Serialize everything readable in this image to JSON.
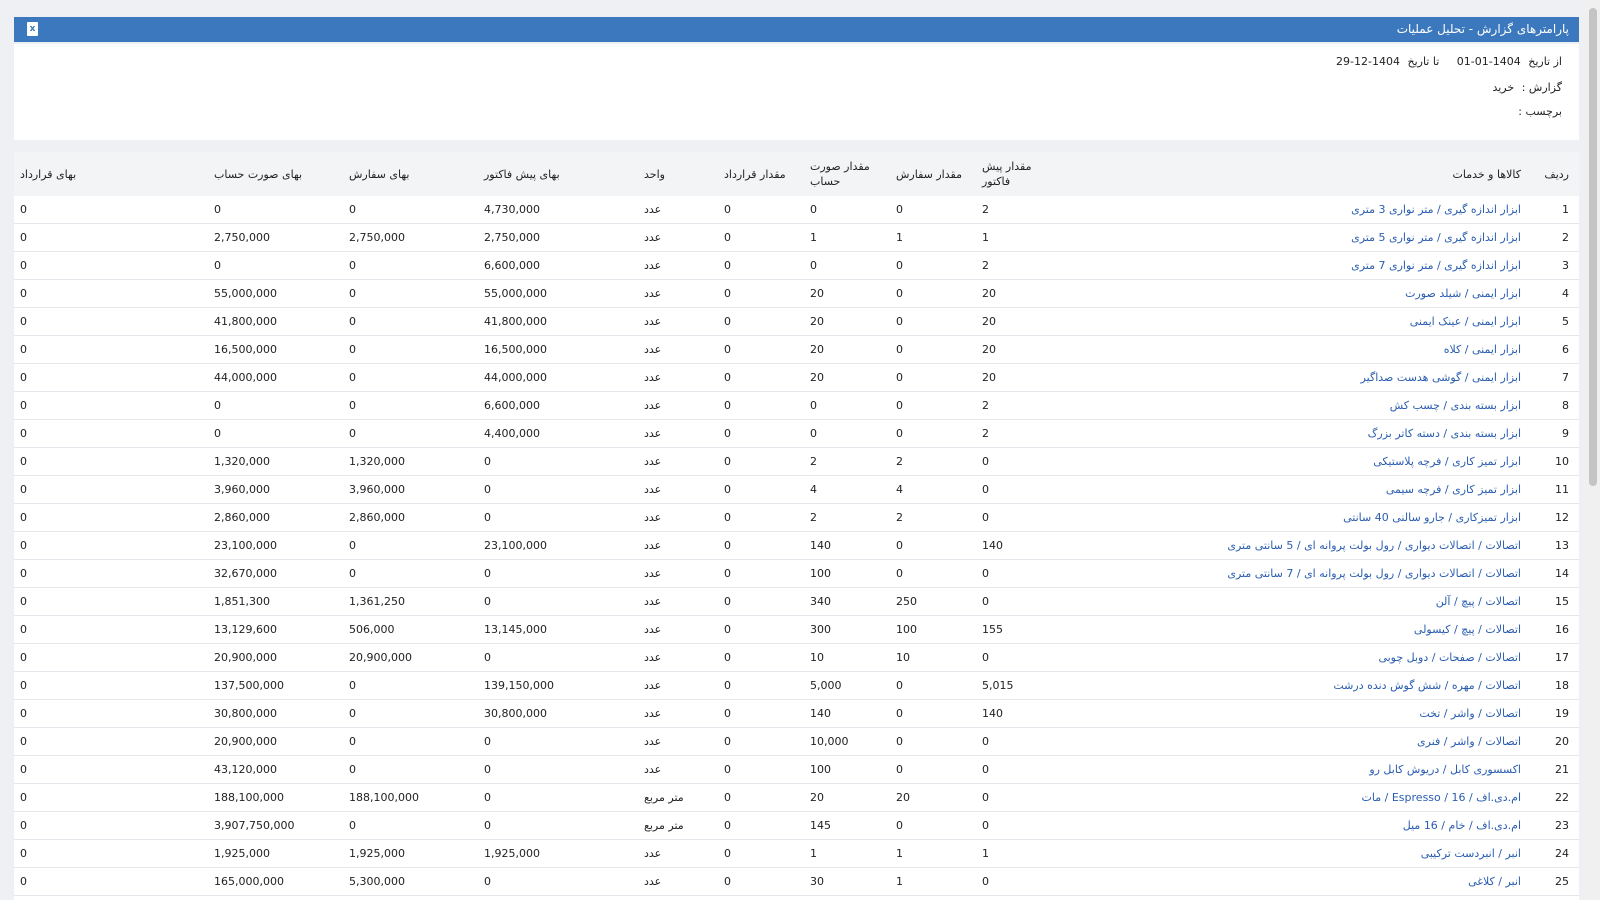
{
  "header": {
    "title": "پارامترهای گزارش - تحلیل عملیات",
    "export_icon": "excel-icon"
  },
  "params": {
    "from_label": "از تاریخ",
    "from_value": "1404-01-01",
    "to_label": "تا تاریخ",
    "to_value": "1404-12-29",
    "report_label": "گزارش :",
    "report_value": "خرید",
    "tag_label": "برچسب :"
  },
  "table": {
    "columns": [
      "ردیف",
      "کالاها و خدمات",
      "مقدار پیش فاکتور",
      "مقدار سفارش",
      "مقدار صورت حساب",
      "مقدار قرارداد",
      "واحد",
      "بهای پیش فاکتور",
      "بهای سفارش",
      "بهای صورت حساب",
      "بهای قرارداد"
    ],
    "rows": [
      [
        "1",
        "ابزار اندازه گیری / متر نواری 3 متری",
        "2",
        "0",
        "0",
        "0",
        "عدد",
        "4,730,000",
        "0",
        "0",
        "0"
      ],
      [
        "2",
        "ابزار اندازه گیری / متر نواری 5 متری",
        "1",
        "1",
        "1",
        "0",
        "عدد",
        "2,750,000",
        "2,750,000",
        "2,750,000",
        "0"
      ],
      [
        "3",
        "ابزار اندازه گیری / متر نواری 7 متری",
        "2",
        "0",
        "0",
        "0",
        "عدد",
        "6,600,000",
        "0",
        "0",
        "0"
      ],
      [
        "4",
        "ابزار ایمنی / شیلد صورت",
        "20",
        "0",
        "20",
        "0",
        "عدد",
        "55,000,000",
        "0",
        "55,000,000",
        "0"
      ],
      [
        "5",
        "ابزار ایمنی / عینک ایمنی",
        "20",
        "0",
        "20",
        "0",
        "عدد",
        "41,800,000",
        "0",
        "41,800,000",
        "0"
      ],
      [
        "6",
        "ابزار ایمنی / کلاه",
        "20",
        "0",
        "20",
        "0",
        "عدد",
        "16,500,000",
        "0",
        "16,500,000",
        "0"
      ],
      [
        "7",
        "ابزار ایمنی / گوشی هدست صداگیر",
        "20",
        "0",
        "20",
        "0",
        "عدد",
        "44,000,000",
        "0",
        "44,000,000",
        "0"
      ],
      [
        "8",
        "ابزار بسته بندی / چسب کش",
        "2",
        "0",
        "0",
        "0",
        "عدد",
        "6,600,000",
        "0",
        "0",
        "0"
      ],
      [
        "9",
        "ابزار بسته بندی / دسته کاتر بزرگ",
        "2",
        "0",
        "0",
        "0",
        "عدد",
        "4,400,000",
        "0",
        "0",
        "0"
      ],
      [
        "10",
        "ابزار تمیز کاری / فرچه پلاستیکی",
        "0",
        "2",
        "2",
        "0",
        "عدد",
        "0",
        "1,320,000",
        "1,320,000",
        "0"
      ],
      [
        "11",
        "ابزار تمیز کاری / فرچه سیمی",
        "0",
        "4",
        "4",
        "0",
        "عدد",
        "0",
        "3,960,000",
        "3,960,000",
        "0"
      ],
      [
        "12",
        "ابزار تمیزکاری / جارو سالنی 40 سانتی",
        "0",
        "2",
        "2",
        "0",
        "عدد",
        "0",
        "2,860,000",
        "2,860,000",
        "0"
      ],
      [
        "13",
        "اتصالات / اتصالات دیواری / رول بولت پروانه ای / 5 سانتی متری",
        "140",
        "0",
        "140",
        "0",
        "عدد",
        "23,100,000",
        "0",
        "23,100,000",
        "0"
      ],
      [
        "14",
        "اتصالات / اتصالات دیواری / رول بولت پروانه ای / 7 سانتی متری",
        "0",
        "0",
        "100",
        "0",
        "عدد",
        "0",
        "0",
        "32,670,000",
        "0"
      ],
      [
        "15",
        "اتصالات / پیچ / آلن",
        "0",
        "250",
        "340",
        "0",
        "عدد",
        "0",
        "1,361,250",
        "1,851,300",
        "0"
      ],
      [
        "16",
        "اتصالات / پیچ / کیسولی",
        "155",
        "100",
        "300",
        "0",
        "عدد",
        "13,145,000",
        "506,000",
        "13,129,600",
        "0"
      ],
      [
        "17",
        "اتصالات / صفحات / دوبل چوبی",
        "0",
        "10",
        "10",
        "0",
        "عدد",
        "0",
        "20,900,000",
        "20,900,000",
        "0"
      ],
      [
        "18",
        "اتصالات / مهره / شش گوش دنده درشت",
        "5,015",
        "0",
        "5,000",
        "0",
        "عدد",
        "139,150,000",
        "0",
        "137,500,000",
        "0"
      ],
      [
        "19",
        "اتصالات / واشر / تخت",
        "140",
        "0",
        "140",
        "0",
        "عدد",
        "30,800,000",
        "0",
        "30,800,000",
        "0"
      ],
      [
        "20",
        "اتصالات / واشر / فنری",
        "0",
        "0",
        "10,000",
        "0",
        "عدد",
        "0",
        "0",
        "20,900,000",
        "0"
      ],
      [
        "21",
        "اکسسوری کابل / دریوش کابل رو",
        "0",
        "0",
        "100",
        "0",
        "عدد",
        "0",
        "0",
        "43,120,000",
        "0"
      ],
      [
        "22",
        "ام.دی.اف / Espresso / 16 / مات",
        "0",
        "20",
        "20",
        "0",
        "متر مربع",
        "0",
        "188,100,000",
        "188,100,000",
        "0"
      ],
      [
        "23",
        "ام.دی.اف / خام / 16 میل",
        "0",
        "0",
        "145",
        "0",
        "متر مربع",
        "0",
        "0",
        "3,907,750,000",
        "0"
      ],
      [
        "24",
        "انبر / انبردست ترکیبی",
        "1",
        "1",
        "1",
        "0",
        "عدد",
        "1,925,000",
        "1,925,000",
        "1,925,000",
        "0"
      ],
      [
        "25",
        "انبر / کلاغی",
        "0",
        "1",
        "30",
        "0",
        "عدد",
        "0",
        "5,300,000",
        "165,000,000",
        "0"
      ]
    ]
  }
}
